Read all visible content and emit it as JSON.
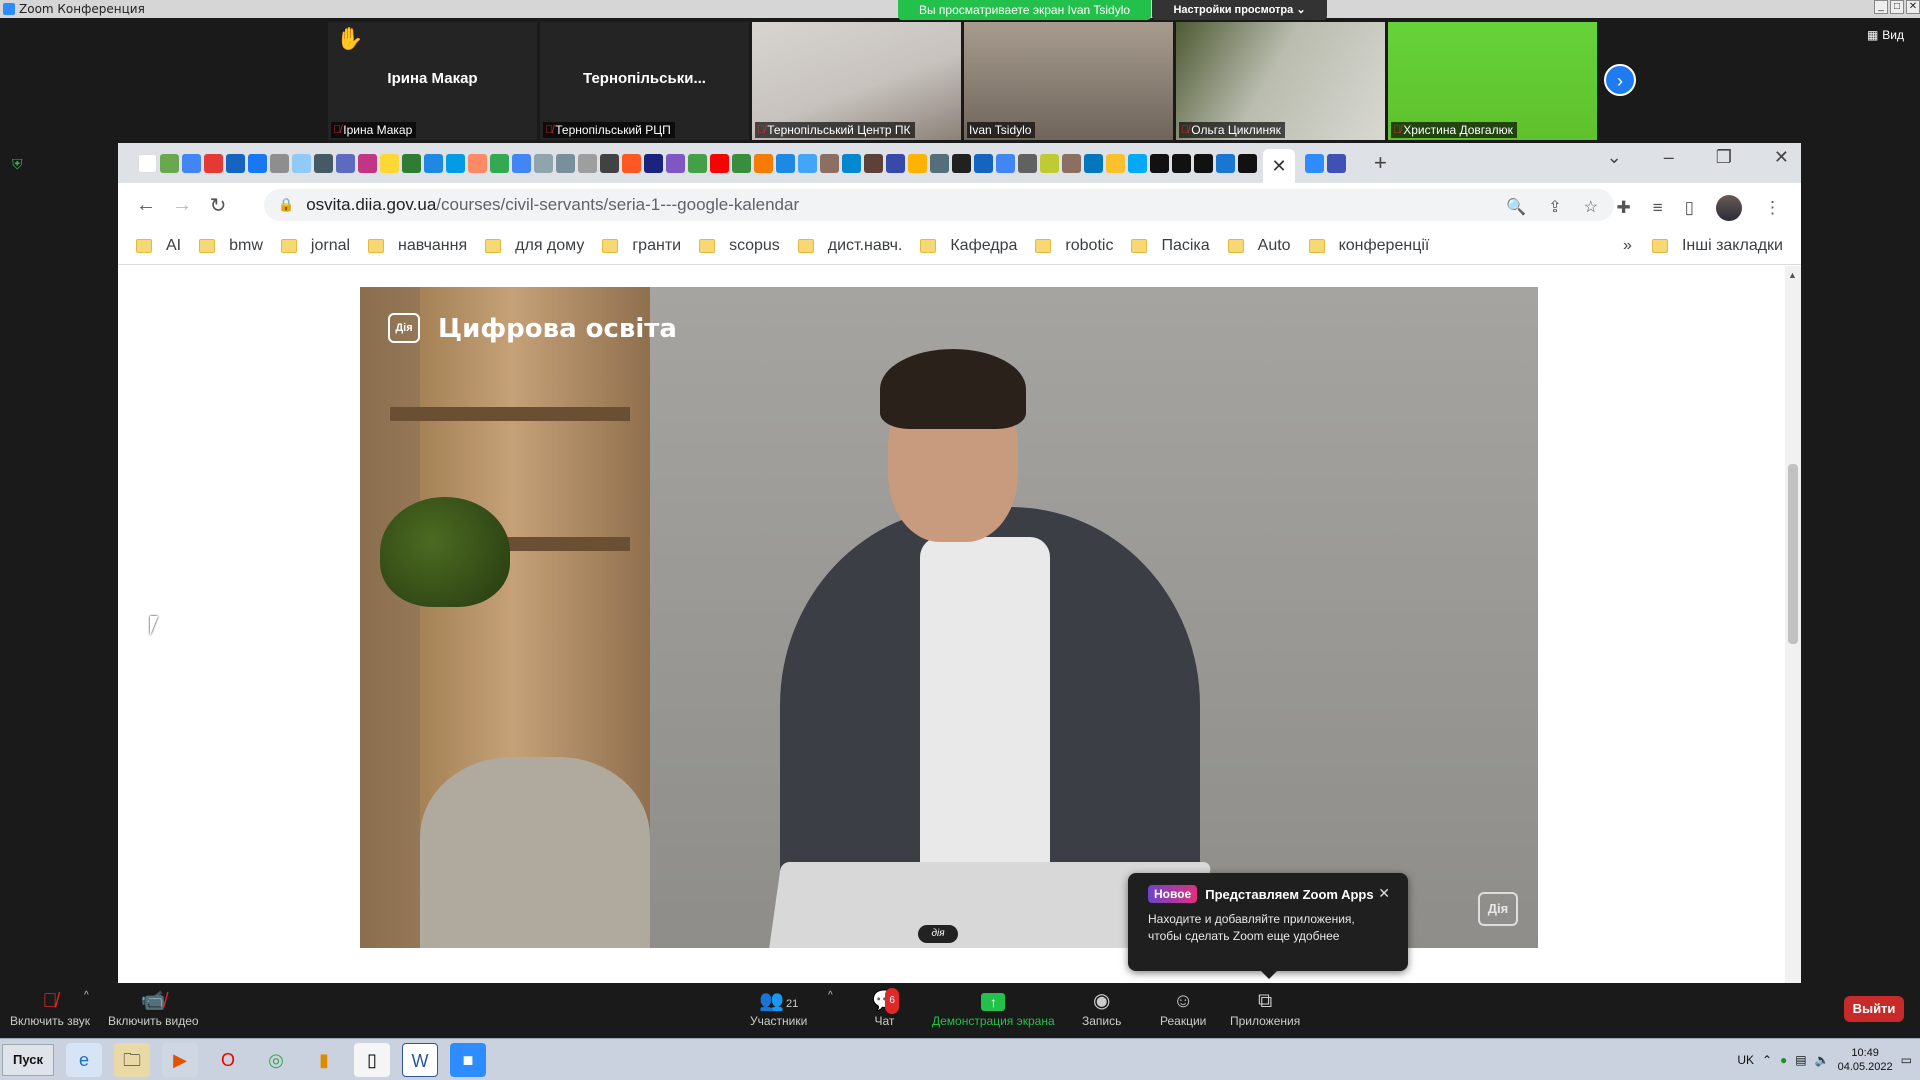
{
  "zoom": {
    "window_title": "Zoom Конференция",
    "share_banner": "Вы просматриваете экран Ivan Tsidylo",
    "view_settings": "Настройки просмотра ⌄",
    "view_label": "Вид"
  },
  "participants": [
    {
      "name_big": "Ірина Макар",
      "label": "Ірина Макар",
      "hand": true,
      "video": false
    },
    {
      "name_big": "Тернопільськи...",
      "label": "Тернопільський РЦП",
      "hand": false,
      "video": false
    },
    {
      "name_big": "",
      "label": "Тернопільський Центр ПК",
      "hand": false,
      "video": true
    },
    {
      "name_big": "",
      "label": "Ivan Tsidylo",
      "hand": false,
      "video": true
    },
    {
      "name_big": "",
      "label": "Ольга Циклиняк",
      "hand": false,
      "video": true
    },
    {
      "name_big": "",
      "label": "Христина Довгалюк",
      "hand": false,
      "video": true
    }
  ],
  "browser": {
    "url_host": "osvita.diia.gov.ua",
    "url_path": "/courses/civil-servants/seria-1---google-kalendar",
    "bookmarks": [
      "AI",
      "bmw",
      "jornal",
      "навчання",
      "для дому",
      "гранти",
      "scopus",
      "дист.навч.",
      "Кафедра",
      "robotic",
      "Пасіка",
      "Auto",
      "конференції"
    ],
    "bookmarks_more": "»",
    "other_bookmarks": "Інші закладки"
  },
  "video": {
    "logo_mark": "Дія",
    "logo_text": "Цифрова освіта",
    "watermark": "Дія",
    "laptop_logo": "дія"
  },
  "tooltip": {
    "badge": "Новое",
    "title": "Представляем Zoom Apps",
    "body_line1": "Находите и добавляйте приложения,",
    "body_line2": "чтобы сделать Zoom еще удобнее"
  },
  "controls": {
    "audio": "Включить звук",
    "video": "Включить видео",
    "participants": "Участники",
    "participants_count": "21",
    "chat": "Чат",
    "chat_badge": "6",
    "share": "Демонстрация экрана",
    "record": "Запись",
    "reactions": "Реакции",
    "apps": "Приложения",
    "leave": "Выйти"
  },
  "taskbar": {
    "start": "Пуск",
    "lang": "UK",
    "time": "10:49",
    "date": "04.05.2022"
  }
}
